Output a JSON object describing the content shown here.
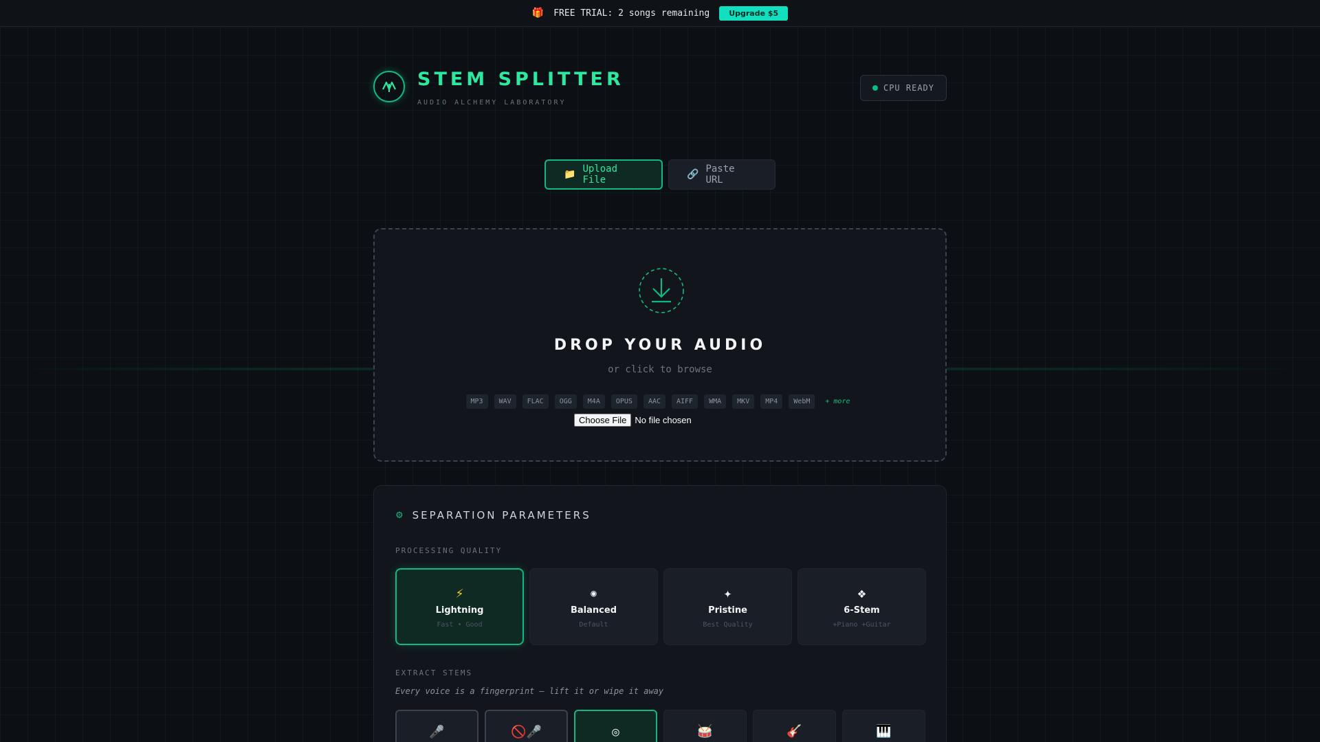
{
  "trial_bar": {
    "icon": "gift-icon",
    "text": "FREE TRIAL: 2 songs remaining",
    "upgrade_label": "Upgrade $5"
  },
  "header": {
    "logo_icon": "waveform-logo-icon",
    "title": "STEM SPLITTER",
    "subtitle": "AUDIO ALCHEMY LABORATORY",
    "status": "CPU READY",
    "status_color": "#10b981"
  },
  "source_tabs": [
    {
      "icon": "📁",
      "label": "Upload File",
      "active": true
    },
    {
      "icon": "🔗",
      "label": "Paste URL",
      "active": false
    }
  ],
  "dropzone": {
    "title": "DROP YOUR AUDIO",
    "subtitle": "or click to browse",
    "formats": [
      "MP3",
      "WAV",
      "FLAC",
      "OGG",
      "M4A",
      "OPUS",
      "AAC",
      "AIFF",
      "WMA",
      "MKV",
      "MP4",
      "WebM"
    ],
    "more": "+ more",
    "file_button": "Choose File",
    "file_status": "No file chosen"
  },
  "params": {
    "title": "SEPARATION PARAMETERS",
    "quality_label": "PROCESSING QUALITY",
    "quality_options": [
      {
        "icon": "⚡",
        "name": "Lightning",
        "sub": "Fast • Good",
        "selected": true
      },
      {
        "icon": "◉",
        "name": "Balanced",
        "sub": "Default",
        "selected": false
      },
      {
        "icon": "✦",
        "name": "Pristine",
        "sub": "Best Quality",
        "selected": false
      },
      {
        "icon": "❖",
        "name": "6-Stem",
        "sub": "+Piano +Guitar",
        "selected": false
      }
    ],
    "stems_label": "EXTRACT STEMS",
    "stems_tagline": "Every voice is a fingerprint — lift it or wipe it away",
    "stems": [
      {
        "icon": "🎤",
        "icon_name": "microphone-icon"
      },
      {
        "icon": "🚫🎤",
        "icon_name": "no-vocals-icon"
      },
      {
        "icon": "◎",
        "icon_name": "target-icon"
      },
      {
        "icon": "🥁",
        "icon_name": "drum-icon"
      },
      {
        "icon": "🎸",
        "icon_name": "guitar-icon"
      },
      {
        "icon": "🎹",
        "icon_name": "piano-icon"
      }
    ]
  },
  "accent_color": "#10b981"
}
